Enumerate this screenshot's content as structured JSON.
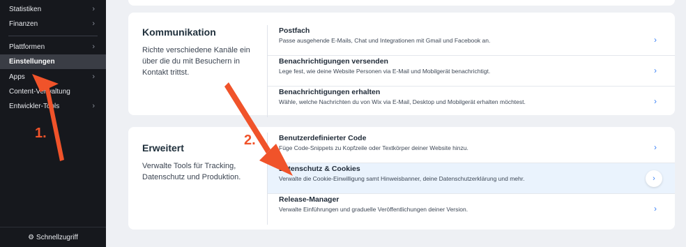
{
  "sidebar": {
    "items": [
      {
        "label": "Statistiken",
        "chevron": true
      },
      {
        "label": "Finanzen",
        "chevron": true
      },
      {
        "label": "Plattformen",
        "chevron": true
      },
      {
        "label": "Einstellungen",
        "chevron": false,
        "active": true
      },
      {
        "label": "Apps",
        "chevron": true
      },
      {
        "label": "Content-Verwaltung",
        "chevron": false
      },
      {
        "label": "Entwickler-Tools",
        "chevron": true
      }
    ],
    "footer": "Schnellzugriff"
  },
  "sections": [
    {
      "title": "Kommunikation",
      "description": "Richte verschiedene Kanäle ein über die du mit Besuchern in Kontakt trittst.",
      "rows": [
        {
          "title": "Postfach",
          "desc": "Passe ausgehende E-Mails, Chat und Integrationen mit Gmail und Facebook an."
        },
        {
          "title": "Benachrichtigungen versenden",
          "desc": "Lege fest, wie deine Website Personen via E-Mail und Mobilgerät benachrichtigt."
        },
        {
          "title": "Benachrichtigungen erhalten",
          "desc": "Wähle, welche Nachrichten du von Wix via E-Mail, Desktop und Mobilgerät erhalten möchtest."
        }
      ]
    },
    {
      "title": "Erweitert",
      "description": "Verwalte Tools für Tracking, Datenschutz und Produktion.",
      "rows": [
        {
          "title": "Benutzerdefinierter Code",
          "desc": "Füge Code-Snippets zu Kopfzeile oder Textkörper deiner Website hinzu."
        },
        {
          "title": "Datenschutz & Cookies",
          "desc": "Verwalte die Cookie-Einwilligung samt Hinweisbanner, deine Datenschutzerklärung und mehr.",
          "highlighted": true
        },
        {
          "title": "Release-Manager",
          "desc": "Verwalte Einführungen und graduelle Veröffentlichungen deiner Version."
        }
      ]
    }
  ],
  "annotations": {
    "step1": "1.",
    "step2": "2.",
    "color": "#f0532a"
  },
  "icons": {
    "chevron": "›",
    "gear": "⚙"
  }
}
